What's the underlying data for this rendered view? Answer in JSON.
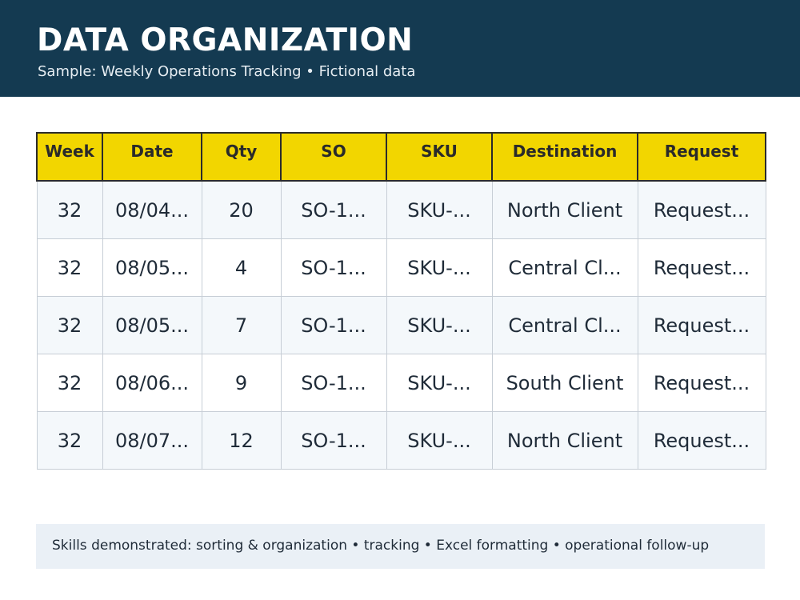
{
  "header": {
    "title": "DATA ORGANIZATION",
    "subtitle": "Sample: Weekly Operations Tracking  •  Fictional data"
  },
  "table": {
    "columns": [
      "Week",
      "Date",
      "Qty",
      "SO",
      "SKU",
      "Destination",
      "Request"
    ],
    "rows": [
      [
        "32",
        "08/04...",
        "20",
        "SO-1...",
        "SKU-...",
        "North Client",
        "Request..."
      ],
      [
        "32",
        "08/05...",
        "4",
        "SO-1...",
        "SKU-...",
        "Central Cl...",
        "Request..."
      ],
      [
        "32",
        "08/05...",
        "7",
        "SO-1...",
        "SKU-...",
        "Central Cl...",
        "Request..."
      ],
      [
        "32",
        "08/06...",
        "9",
        "SO-1...",
        "SKU-...",
        "South Client",
        "Request..."
      ],
      [
        "32",
        "08/07...",
        "12",
        "SO-1...",
        "SKU-...",
        "North Client",
        "Request..."
      ]
    ]
  },
  "footer": {
    "text": "Skills demonstrated: sorting & organization • tracking • Excel formatting • operational follow-up"
  },
  "colors": {
    "header_bg": "#143a51",
    "column_header_bg": "#f2d600",
    "row_alt_bg": "#f4f8fb",
    "footer_bg": "#eaf0f6"
  }
}
